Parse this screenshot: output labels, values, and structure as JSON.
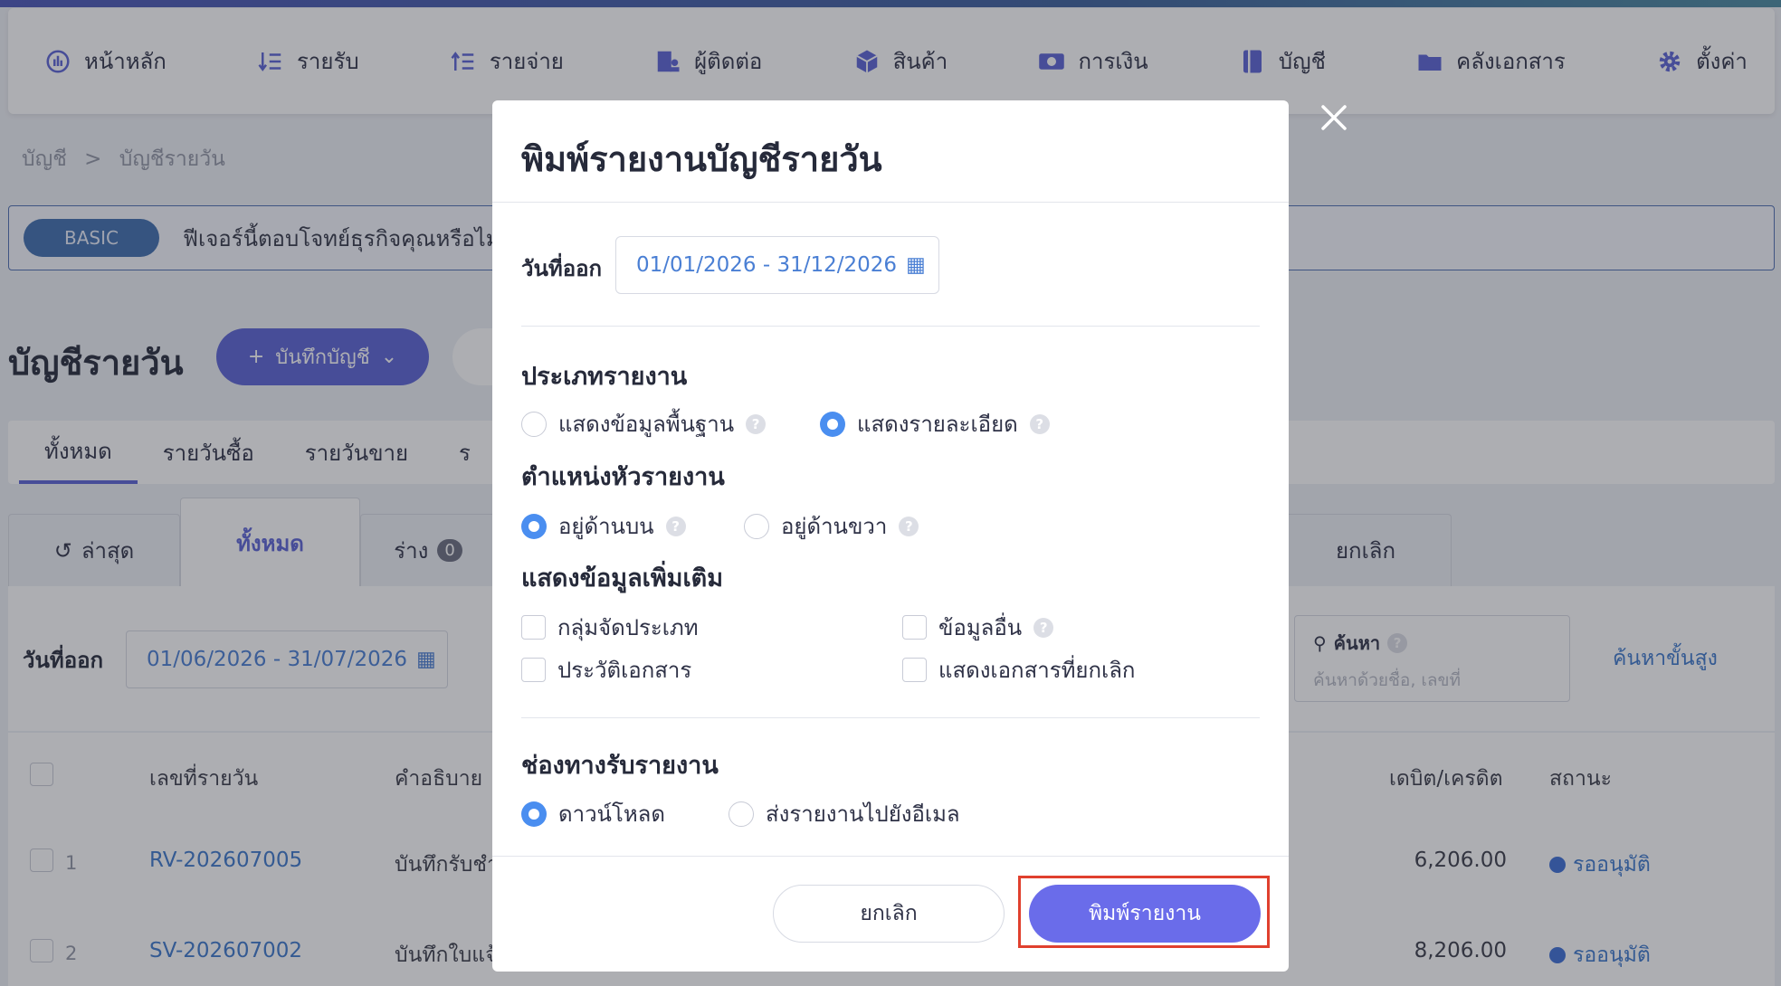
{
  "nav": {
    "items": [
      {
        "label": "หน้าหลัก",
        "icon": "dashboard-icon"
      },
      {
        "label": "รายรับ",
        "icon": "income-icon"
      },
      {
        "label": "รายจ่าย",
        "icon": "expense-icon"
      },
      {
        "label": "ผู้ติดต่อ",
        "icon": "contacts-icon"
      },
      {
        "label": "สินค้า",
        "icon": "box-icon"
      },
      {
        "label": "การเงิน",
        "icon": "money-icon"
      },
      {
        "label": "บัญชี",
        "icon": "ledger-icon"
      },
      {
        "label": "คลังเอกสาร",
        "icon": "folder-icon"
      },
      {
        "label": "ตั้งค่า",
        "icon": "gear-icon"
      }
    ]
  },
  "breadcrumb": {
    "root": "บัญชี",
    "separator": ">",
    "current": "บัญชีรายวัน"
  },
  "banner": {
    "badge": "BASIC",
    "text": "ฟีเจอร์นี้ตอบโจทย์ธุรกิจคุณหรือไม่?"
  },
  "page": {
    "title": "บัญชีรายวัน",
    "record_button": "บันทึกบัญชี"
  },
  "tabs_primary": [
    "ทั้งหมด",
    "รายวันซื้อ",
    "รายวันขาย",
    "ร"
  ],
  "tabs_status": {
    "latest": "ล่าสุด",
    "all": "ทั้งหมด",
    "draft": "ร่าง",
    "draft_count": "0",
    "cancelled": "ยกเลิก"
  },
  "filter": {
    "date_label": "วันที่ออก",
    "date_value": "01/06/2026 - 31/07/2026",
    "search_title": "ค้นหา",
    "search_placeholder": "ค้นหาด้วยชื่อ, เลขที่",
    "advanced": "ค้นหาขั้นสูง"
  },
  "table": {
    "headers": {
      "doc_no": "เลขที่รายวัน",
      "desc": "คำอธิบาย",
      "amount": "เดบิต/เครดิต",
      "status": "สถานะ"
    },
    "rows": [
      {
        "num": "1",
        "doc_no": "RV-202607005",
        "desc": "บันทึกรับชำ",
        "amount": "6,206.00",
        "status": "รออนุมัติ"
      },
      {
        "num": "2",
        "doc_no": "SV-202607002",
        "desc": "บันทึกใบแจ้",
        "amount": "8,206.00",
        "status": "รออนุมัติ"
      }
    ]
  },
  "modal": {
    "title": "พิมพ์รายงานบัญชีรายวัน",
    "date_label": "วันที่ออก",
    "date_value": "01/01/2026 - 31/12/2026",
    "report_type": {
      "title": "ประเภทรายงาน",
      "basic": "แสดงข้อมูลพื้นฐาน",
      "detail": "แสดงรายละเอียด",
      "selected": "detail"
    },
    "header_position": {
      "title": "ตำแหน่งหัวรายงาน",
      "top": "อยู่ด้านบน",
      "right": "อยู่ด้านขวา",
      "selected": "top"
    },
    "extra": {
      "title": "แสดงข้อมูลเพิ่มเติม",
      "category_group": "กลุ่มจัดประเภท",
      "other_info": "ข้อมูลอื่น",
      "doc_history": "ประวัติเอกสาร",
      "show_cancelled": "แสดงเอกสารที่ยกเลิก"
    },
    "channel": {
      "title": "ช่องทางรับรายงาน",
      "download": "ดาวน์โหลด",
      "email": "ส่งรายงานไปยังอีเมล",
      "selected": "download"
    },
    "cancel_button": "ยกเลิก",
    "print_button": "พิมพ์รายงาน",
    "help_symbol": "?"
  },
  "colors": {
    "accent": "#5b63d6",
    "link": "#3d78cc",
    "radio_on": "#4a8ef0",
    "highlight": "#e0402e"
  }
}
